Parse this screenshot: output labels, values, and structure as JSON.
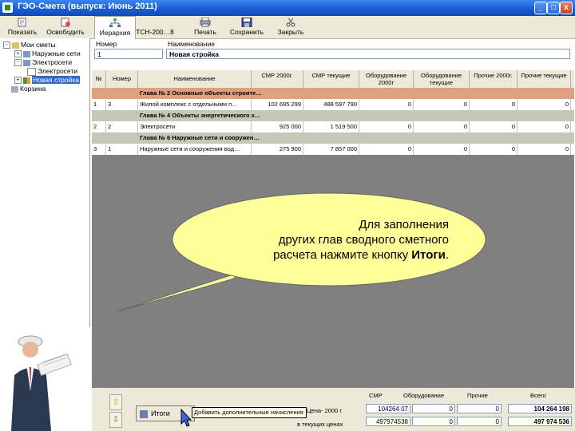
{
  "window": {
    "title": "ГЭО-Смета  (выпуск: Июнь 2011)",
    "buttons": [
      "_",
      "□",
      "x"
    ]
  },
  "toolbar": {
    "items": [
      {
        "label": "Показать",
        "icon": "show-icon"
      },
      {
        "label": "Освободить",
        "icon": "release-icon"
      },
      {
        "label": "Иерархия",
        "icon": "hierarchy-icon",
        "active": true
      },
      {
        "label": "ТСН-200…8",
        "icon": "tsn-icon"
      },
      {
        "label": "Печать",
        "icon": "printer-icon"
      },
      {
        "label": "Сохранить",
        "icon": "save-icon"
      },
      {
        "label": "Закрыть",
        "icon": "close-scissors-icon"
      }
    ]
  },
  "tree": {
    "items": [
      {
        "label": "Мои сметы",
        "level": 0,
        "expander": "-"
      },
      {
        "label": "Наружные сети",
        "level": 1,
        "expander": "+"
      },
      {
        "label": "Электросети",
        "level": 1,
        "expander": "-"
      },
      {
        "label": "Электросети",
        "level": 2,
        "expander": ""
      },
      {
        "label": "Новая стройка",
        "level": 1,
        "expander": "+",
        "selected": true
      },
      {
        "label": "Корзина",
        "level": 0,
        "expander": ""
      }
    ]
  },
  "form": {
    "number_label": "Номер",
    "number_value": "1",
    "name_label": "Наименование",
    "name_value": "Новая стройка"
  },
  "grid": {
    "columns": [
      "№",
      "Номер",
      "Наименование",
      "СМР 2000г.",
      "СМР текущие",
      "Оборудование 2000г",
      "Оборудование текущие",
      "Прочие 2000г.",
      "Прочие текущие"
    ],
    "rows": [
      {
        "type": "chapter",
        "name": "Глава № 2   Основные объекты строите…"
      },
      {
        "type": "data",
        "n": "1",
        "num": "3",
        "name": "Жилой комплекс с отдельными п…",
        "smr2000": "102 695 299",
        "smrcur": "488 597 790",
        "eq2000": "0",
        "eqcur": "0",
        "oth2000": "0",
        "othcur": "0"
      },
      {
        "type": "chapter",
        "name": "Глава № 4   Объекты энергетического х…"
      },
      {
        "type": "data",
        "n": "2",
        "num": "2",
        "name": "Электросети",
        "smr2000": "925 000",
        "smrcur": "1 519 500",
        "eq2000": "0",
        "eqcur": "0",
        "oth2000": "0",
        "othcur": "0"
      },
      {
        "type": "chapter",
        "name": "Глава № 6   Наружные сети и сооружен…"
      },
      {
        "type": "data",
        "n": "3",
        "num": "1",
        "name": "Наружные сети и сооружения вод…",
        "smr2000": "275 900",
        "smrcur": "7 857 000",
        "eq2000": "0",
        "eqcur": "0",
        "oth2000": "0",
        "othcur": "0"
      }
    ]
  },
  "hint": {
    "line1": "Для заполнения",
    "line2": "других глав сводного сметного",
    "line3_prefix": "расчета нажмите кнопку ",
    "line3_bold": "Итоги",
    "line3_suffix": "."
  },
  "bottom": {
    "itogi_label": "Итоги",
    "tooltip": "Добавить дополнительные начисления",
    "col_smr": "СМР",
    "col_eq": "Оборудование",
    "col_other": "Прочие",
    "col_total": "Всего",
    "row1_label": "Цена- 2000 г",
    "row2_label": "в текущих ценах",
    "row1": {
      "smr": "104264 07",
      "eq": "0",
      "other": "0",
      "total": "104 264 198"
    },
    "row2": {
      "smr": "497974538",
      "eq": "0",
      "other": "0",
      "total": "497 974 536"
    }
  },
  "colors": {
    "titlebar": "#1a5ed8",
    "chapter_row": "#c8c6b6",
    "selected_row": "#e0a080",
    "callout": "#ffff99"
  }
}
